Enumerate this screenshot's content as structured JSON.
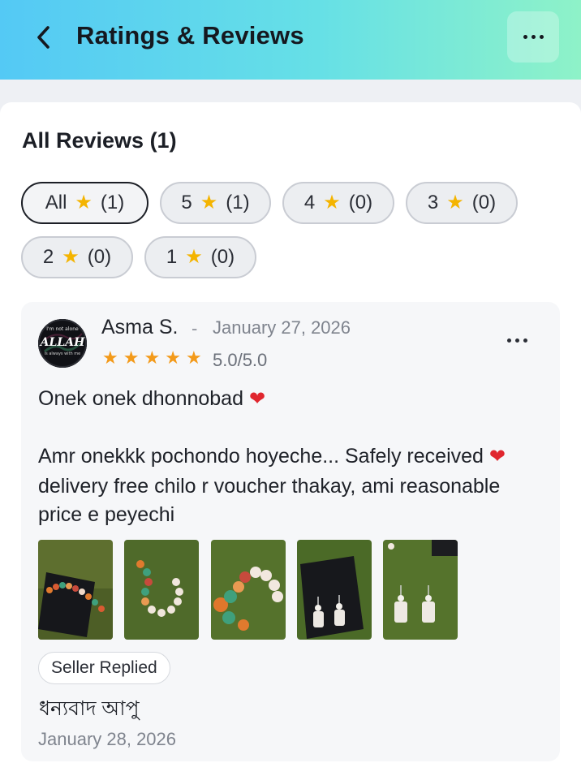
{
  "header": {
    "title": "Ratings & Reviews"
  },
  "section": {
    "title": "All Reviews (1)"
  },
  "filters": [
    {
      "label": "All",
      "count": "(1)"
    },
    {
      "label": "5",
      "count": "(1)"
    },
    {
      "label": "4",
      "count": "(0)"
    },
    {
      "label": "3",
      "count": "(0)"
    },
    {
      "label": "2",
      "count": "(0)"
    },
    {
      "label": "1",
      "count": "(0)"
    }
  ],
  "review": {
    "reviewer": "Asma S.",
    "separator": "-",
    "date": "January 27, 2026",
    "stars": 5,
    "rating_text": "5.0/5.0",
    "avatar_text": {
      "line1": "I'm not alone",
      "line2": "ALLAH",
      "line3": "is always with me"
    },
    "lines": [
      "Onek onek dhonnobad",
      "Amr onekkk pochondo hoyeche... Safely received",
      "delivery free chilo r voucher thakay, ami reasonable",
      "price e peyechi"
    ],
    "heart": "❤",
    "photo_count": 5
  },
  "reply": {
    "badge": "Seller Replied",
    "text": "ধন্যবাদ আপু",
    "date": "January 28, 2026"
  },
  "colors": {
    "accent_star": "#f4b400",
    "heart": "#e0262e",
    "header_start": "#54c9f5",
    "header_end": "#8ef2c8"
  },
  "icons": {
    "back": "chevron-left-icon",
    "more": "more-horizontal-icon",
    "star": "star-icon"
  }
}
